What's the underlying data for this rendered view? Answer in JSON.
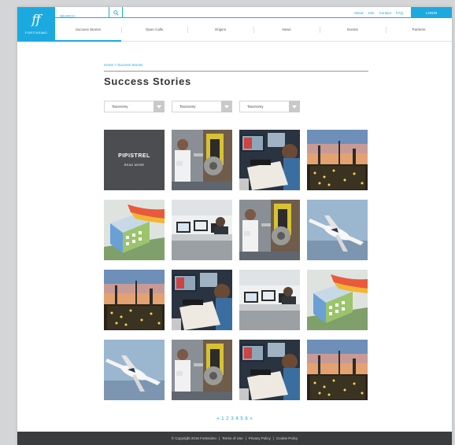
{
  "logo": {
    "mark": "ff",
    "word": "FORTISSIMO"
  },
  "search": {
    "placeholder": "SEARCH"
  },
  "top_links": [
    "About",
    "Join",
    "Contact",
    "FAQ"
  ],
  "login_label": "LOGIN",
  "nav": [
    "Success Stories",
    "Open Calls",
    "Origins",
    "News",
    "Events",
    "Partners"
  ],
  "breadcrumb": "Home > Success Stories",
  "page_title": "Success Stories",
  "filters": [
    "Taxonomy",
    "Taxonomy",
    "Taxonomy"
  ],
  "featured": {
    "brand": "PIPISTREL",
    "cta": "READ MORE"
  },
  "tiles": [
    "featured-pipistrel",
    "scientist-lab",
    "engineer-workstation",
    "refinery-sunset",
    "building-simulation",
    "office-computers",
    "scientist-lab",
    "aircraft-sky",
    "refinery-sunset",
    "engineer-workstation",
    "office-computers",
    "building-simulation",
    "aircraft-sky",
    "scientist-lab",
    "engineer-workstation",
    "refinery-sunset"
  ],
  "pagination": [
    "«",
    "1",
    "2",
    "3",
    "4",
    "5",
    "6",
    "»"
  ],
  "footer": {
    "copyright": "© Copyright 2016 Fortissimo",
    "sep": "|",
    "terms": "Terms of Use",
    "privacy": "Privacy Policy",
    "cookie": "Cookie Policy"
  },
  "colors": {
    "accent": "#1ca9e0",
    "footer_bg": "#3b3c3e",
    "featured_bg": "#4b4d50"
  }
}
